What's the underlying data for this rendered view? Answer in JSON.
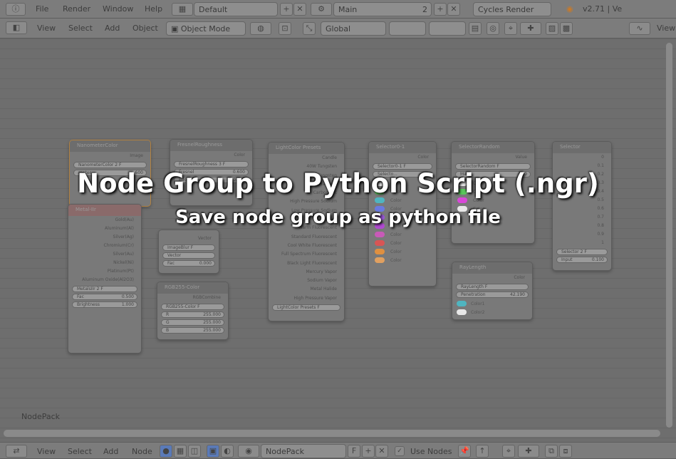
{
  "topbar": {
    "menu": [
      "File",
      "Render",
      "Window",
      "Help"
    ],
    "layout": "Default",
    "scene": "Main",
    "scene_users": "2",
    "engine": "Cycles Render",
    "version": "v2.71 | Ve"
  },
  "header": {
    "menu": [
      "View",
      "Select",
      "Add",
      "Object"
    ],
    "mode": "Object Mode",
    "orientation": "Global",
    "right_menu": "View"
  },
  "overlay": {
    "title": "Node Group to Python Script (.ngr)",
    "subtitle": "Save node group as python file"
  },
  "canvas": {
    "label": "NodePack"
  },
  "footer": {
    "menu": [
      "View",
      "Select",
      "Add",
      "Node"
    ],
    "node_tree": "NodePack",
    "fake_user": "F",
    "use_nodes": "Use Nodes"
  },
  "nodes": {
    "n1": {
      "title": "NanometerColor",
      "rows": [
        "Image"
      ],
      "field": "NanometerColor",
      "num": "2",
      "f": "F",
      "extra": "meter",
      "extra_val": "600"
    },
    "n2": {
      "title": "Metal-IIr",
      "rows": [
        "Gold(Au)",
        "Aluminum(Al)",
        "Silver(Ag)",
        "Chromium(Cr)",
        "Silver(Au)",
        "Nickel(Ni)",
        "Platinum(Pt)",
        "Aluminum Oxide(Al2O3)"
      ],
      "field": "MetalsIIr",
      "num": "2",
      "f": "F",
      "f1": "Fac",
      "v1": "0.500",
      "f2": "Brightness",
      "v2": "1.000"
    },
    "n3": {
      "title": "FresnelRoughness",
      "rows": [
        "Color"
      ],
      "field": "FresnelRoughness",
      "num": "3",
      "f": "F",
      "f1": "Fresnel",
      "v1": "0.600",
      "f2": "Edge",
      "v2": "0.000"
    },
    "n4": {
      "title": "ImageBlur",
      "rows": [
        "Vector"
      ],
      "field": "ImageBlur",
      "f": "F",
      "sel": "Vector",
      "f1": "Fac",
      "v1": "0.000"
    },
    "n5": {
      "title": "RGB255-Color",
      "rows": [
        "RGBCombine"
      ],
      "field": "RGB255-Color",
      "f": "F",
      "r": "255.000",
      "g": "255.000",
      "b": "255.000",
      "rl": "R",
      "gl": "G",
      "bl": "B"
    },
    "n6": {
      "title": "LightColor Presets",
      "rows": [
        "Candle",
        "40W Tungsten",
        "100W Tungsten",
        "Halogen",
        "Carbon Arc",
        "High Pressure Sodium",
        "Low Pressure Sodium",
        "Mercury Vapor",
        "Warm Fluorescent",
        "Standard Fluorescent",
        "Cool White Fluorescent",
        "Full Spectrum Fluorescent",
        "Black Light Fluorescent",
        "Mercury Vapor",
        "Sodium Vapor",
        "Metal Halide",
        "High Pressure Vapor"
      ],
      "field": "LightColor Presets",
      "f": "F"
    },
    "n7": {
      "title": "Selector0-1",
      "rows": [
        "Color"
      ],
      "field": "Selector0-1",
      "f": "F",
      "sel": "Selecto...",
      "sel_val": "0.1",
      "swatch_labels": [
        "Color",
        "Color",
        "Color",
        "Color",
        "Color",
        "Color",
        "Color",
        "Color",
        "Color",
        "Color"
      ],
      "swatches": [
        "#e8e8e8",
        "#59c65b",
        "#4fb5c0",
        "#6a7ae0",
        "#9a58d8",
        "#b04ad0",
        "#c85ab8",
        "#d85555",
        "#e09040",
        "#e0a060"
      ]
    },
    "n8": {
      "title": "SelectorRandom",
      "rows": [
        "Value"
      ],
      "field": "SelectorRandom",
      "f": "F",
      "sel": "Max",
      "sel_val": "100",
      "swatch_labels": [
        "Color",
        "Color",
        "Color",
        "Color"
      ],
      "swatches": [
        "#e8e8e8",
        "#59c65b",
        "#d848d8",
        "#e8e8e8"
      ]
    },
    "n9": {
      "title": "Selector",
      "rows": [
        "0",
        "0.1",
        "0.2",
        "0.3",
        "0.4",
        "0.5",
        "0.6",
        "0.7",
        "0.8",
        "0.9",
        "1"
      ],
      "field": "Selector",
      "num": "2",
      "f": "F",
      "f1": "Input",
      "v1": "0.100"
    },
    "n10": {
      "title": "RayLength",
      "rows": [
        "Color"
      ],
      "field": "RayLength",
      "f": "F",
      "f1": "Penetration",
      "v1": "42.190",
      "c1": "Color1",
      "c2": "Color2"
    }
  }
}
